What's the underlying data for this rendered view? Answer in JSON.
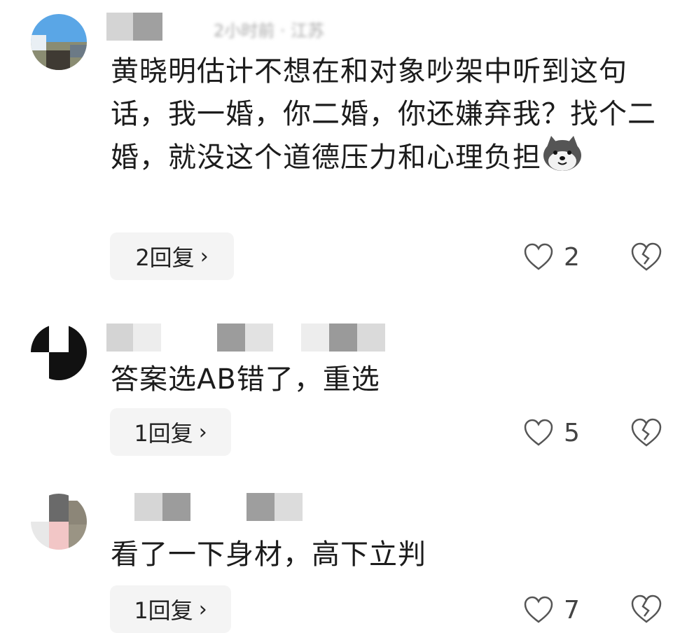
{
  "comments": [
    {
      "meta": "2小时前 · 江苏",
      "text": "黄晓明估计不想在和对象吵架中听到这句话，我一婚，你二婚，你还嫌弃我？找个二婚，就没这个道德压力和心理负担",
      "emoji": "dog-face",
      "reply_label": "2回复",
      "like_count": "2"
    },
    {
      "text": "答案选AB错了，重选",
      "reply_label": "1回复",
      "like_count": "5"
    },
    {
      "text": "看了一下身材，高下立判",
      "reply_label": "1回复",
      "like_count": "7"
    }
  ],
  "icons": {
    "reply_chevron": "›",
    "like": "heart-outline-icon",
    "dislike": "broken-heart-icon"
  },
  "colors": {
    "reply_bg": "#f4f4f4",
    "icon_stroke": "#555555",
    "mosaic_dark": "#9a9a9a",
    "mosaic_light": "#d6d6d6"
  }
}
